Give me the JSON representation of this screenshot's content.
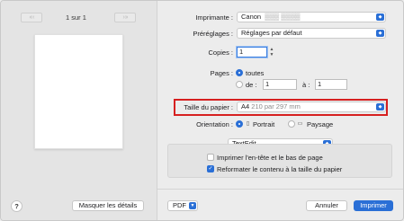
{
  "preview_pane": {
    "prev_nav": "‹‹  ‹",
    "page_counter": "1 sur 1",
    "next_nav": "›  ››",
    "help_label": "?",
    "hide_details_label": "Masquer les détails"
  },
  "settings": {
    "printer_label": "Imprimante :",
    "printer_value": "Canon",
    "presets_label": "Préréglages :",
    "presets_value": "Réglages par défaut",
    "copies_label": "Copies :",
    "copies_value": "1",
    "pages_label": "Pages :",
    "pages_all_label": "toutes",
    "pages_from_label": "de :",
    "pages_from_value": "1",
    "pages_to_label": "à :",
    "pages_to_value": "1",
    "paper_size_label": "Taille du papier :",
    "paper_size_value": "A4",
    "paper_size_dims": "210 par 297 mm",
    "orientation_label": "Orientation :",
    "portrait_label": "Portrait",
    "landscape_label": "Paysage",
    "app_menu_value": "TextEdit",
    "print_header_footer_label": "Imprimer l'en-tête et le bas de page",
    "rewrap_label": "Reformater le contenu à la taille du papier"
  },
  "footer": {
    "pdf_label": "PDF",
    "cancel_label": "Annuler",
    "print_label": "Imprimer"
  },
  "state": {
    "pages_mode": "all",
    "orientation": "portrait",
    "print_header_footer_checked": false,
    "rewrap_checked": true
  },
  "colors": {
    "accent": "#2a6fd6",
    "highlight": "#d62020"
  }
}
